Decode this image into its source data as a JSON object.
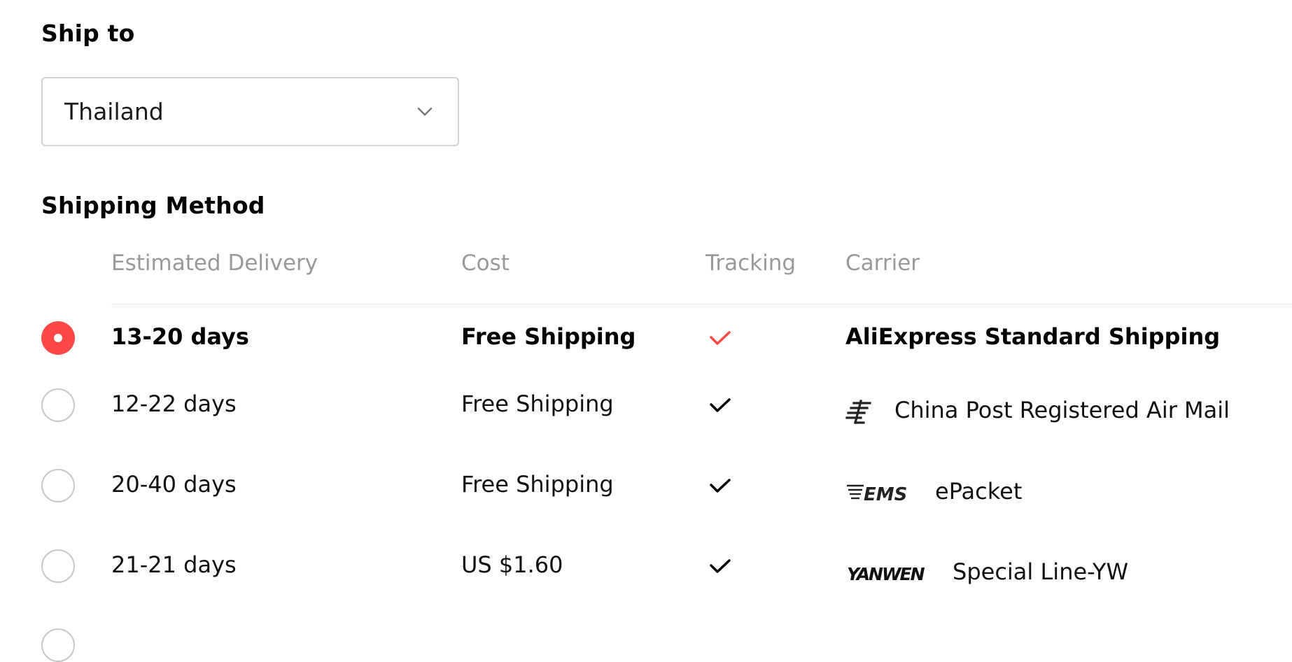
{
  "ship_to": {
    "title": "Ship to",
    "selected_country": "Thailand"
  },
  "shipping_method": {
    "title": "Shipping Method",
    "columns": [
      "Estimated Delivery",
      "Cost",
      "Tracking",
      "Carrier"
    ],
    "rows": [
      {
        "selected": true,
        "delivery": "13-20 days",
        "cost": "Free Shipping",
        "tracking": true,
        "carrier": "AliExpress Standard Shipping",
        "carrier_logo": "none"
      },
      {
        "selected": false,
        "delivery": "12-22 days",
        "cost": "Free Shipping",
        "tracking": true,
        "carrier": "China Post Registered Air Mail",
        "carrier_logo": "china-post-logo"
      },
      {
        "selected": false,
        "delivery": "20-40 days",
        "cost": "Free Shipping",
        "tracking": true,
        "carrier": "ePacket",
        "carrier_logo": "ems-logo"
      },
      {
        "selected": false,
        "delivery": "21-21 days",
        "cost": "US $1.60",
        "tracking": true,
        "carrier": "Special Line-YW",
        "carrier_logo": "yanwen-logo"
      }
    ]
  },
  "colors": {
    "accent": "#ff4747",
    "muted_text": "#999999",
    "border": "#d2d2d2"
  }
}
